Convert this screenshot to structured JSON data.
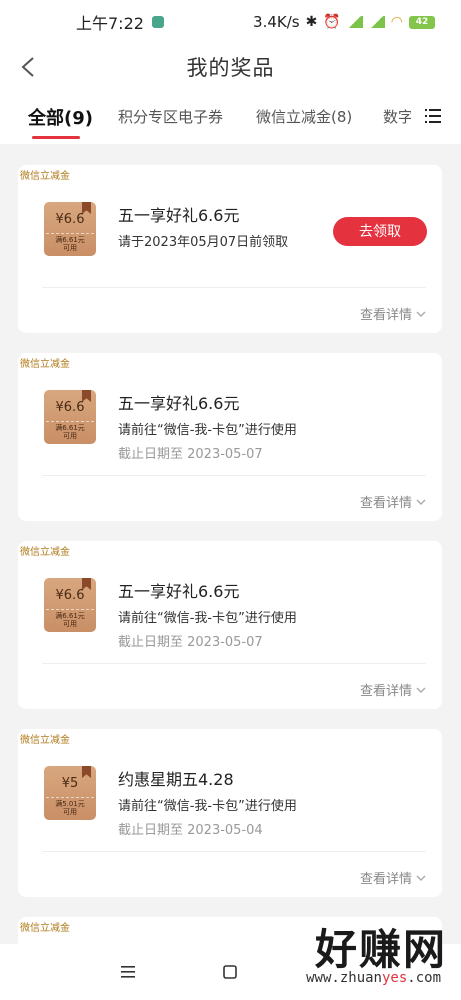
{
  "status_bar": {
    "time": "上午7:22",
    "net_speed": "3.4K/s",
    "battery": "42"
  },
  "header": {
    "title": "我的奖品"
  },
  "tabs": [
    {
      "label": "全部(9)",
      "active": true
    },
    {
      "label": "积分专区电子券",
      "active": false
    },
    {
      "label": "微信立减金(8)",
      "active": false
    },
    {
      "label": "数字",
      "active": false
    }
  ],
  "cards": [
    {
      "tag": "微信立减金",
      "coupon_amount": "¥6.6",
      "coupon_cond_1": "满6.61元",
      "coupon_cond_2": "可用",
      "title": "五一享好礼6.6元",
      "line1": "请于2023年05月07日前领取",
      "line2": "",
      "button": "去领取",
      "detail": "查看详情"
    },
    {
      "tag": "微信立减金",
      "coupon_amount": "¥6.6",
      "coupon_cond_1": "满6.61元",
      "coupon_cond_2": "可用",
      "title": "五一享好礼6.6元",
      "line1": "请前往“微信-我-卡包”进行使用",
      "line2": "截止日期至 2023-05-07",
      "detail": "查看详情"
    },
    {
      "tag": "微信立减金",
      "coupon_amount": "¥6.6",
      "coupon_cond_1": "满6.61元",
      "coupon_cond_2": "可用",
      "title": "五一享好礼6.6元",
      "line1": "请前往“微信-我-卡包”进行使用",
      "line2": "截止日期至 2023-05-07",
      "detail": "查看详情"
    },
    {
      "tag": "微信立减金",
      "coupon_amount": "¥5",
      "coupon_cond_1": "满5.01元",
      "coupon_cond_2": "可用",
      "title": "约惠星期五4.28",
      "line1": "请前往“微信-我-卡包”进行使用",
      "line2": "截止日期至 2023-05-04",
      "detail": "查看详情"
    },
    {
      "tag": "微信立减金"
    }
  ],
  "watermark": {
    "main": "好赚网",
    "sub_1": "www.zhuan",
    "sub_2": "yes",
    "sub_3": ".com"
  },
  "colors": {
    "accent": "#e5323f",
    "coupon": "#c98f66",
    "tag": "#b07a1a"
  }
}
